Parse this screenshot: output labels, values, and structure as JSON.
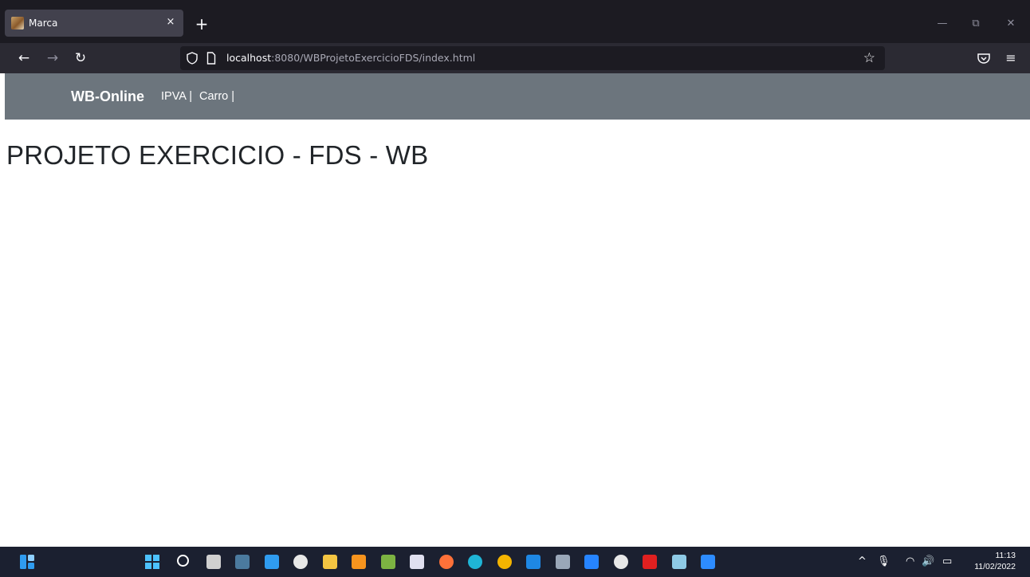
{
  "browser": {
    "tab": {
      "title": "Marca",
      "close_glyph": "×"
    },
    "new_tab_glyph": "+",
    "window_controls": {
      "minimize": "—",
      "restore": "⧉",
      "close": "✕"
    },
    "nav": {
      "back": "←",
      "forward": "→",
      "reload": "↻"
    },
    "url": {
      "host": "localhost",
      "rest": ":8080/WBProjetoExercicioFDS/index.html"
    },
    "bookmark_glyph": "☆",
    "menu_glyph": "≡"
  },
  "site": {
    "brand": "WB-Online",
    "links": [
      "IPVA |",
      "Carro |"
    ],
    "heading": "PROJETO EXERCICIO - FDS - WB"
  },
  "taskbar": {
    "apps": [
      {
        "name": "search-icon",
        "color": "#ffffff"
      },
      {
        "name": "task-view-icon",
        "color": "#d0d0d0"
      },
      {
        "name": "mysql-workbench-icon",
        "color": "#4b7a9e"
      },
      {
        "name": "vscode-icon",
        "color": "#2f9cf0"
      },
      {
        "name": "github-desktop-icon",
        "color": "#e8e8e8"
      },
      {
        "name": "file-explorer-icon",
        "color": "#f4c542"
      },
      {
        "name": "eclipse-icon",
        "color": "#f7941e"
      },
      {
        "name": "notepad-plus-icon",
        "color": "#7cb342"
      },
      {
        "name": "snipping-tool-icon",
        "color": "#e0e0f0"
      },
      {
        "name": "firefox-icon",
        "color": "#ff7139"
      },
      {
        "name": "edge-icon",
        "color": "#1fb5d6"
      },
      {
        "name": "chrome-icon",
        "color": "#f4b400"
      },
      {
        "name": "mail-icon",
        "color": "#1e88e5"
      },
      {
        "name": "settings-icon",
        "color": "#9aa7b8"
      },
      {
        "name": "sourcetree-icon",
        "color": "#2684ff"
      },
      {
        "name": "github-icon",
        "color": "#e8e8e8"
      },
      {
        "name": "acrobat-icon",
        "color": "#e02020"
      },
      {
        "name": "notepad-icon",
        "color": "#8ecae6"
      },
      {
        "name": "zoom-icon",
        "color": "#2d8cff"
      }
    ],
    "tray": {
      "chevron": "^",
      "mic": "🎙",
      "wifi": "◠",
      "volume": "🔊",
      "battery": "▭"
    },
    "clock": {
      "time": "11:13",
      "date": "11/02/2022"
    }
  }
}
